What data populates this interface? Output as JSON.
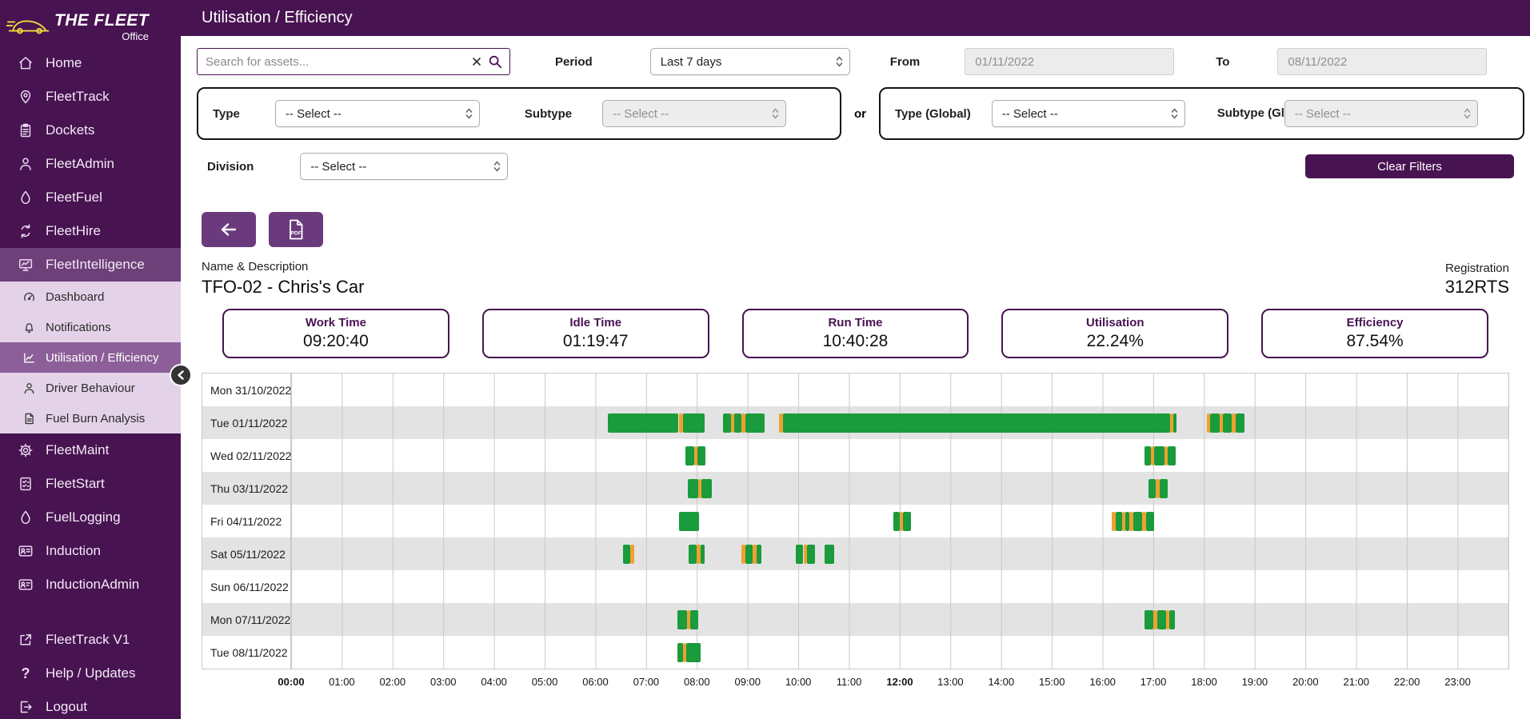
{
  "header": {
    "title": "Utilisation / Efficiency"
  },
  "sidebar": {
    "logo_title": "THE FLEET",
    "logo_subtitle": "Office",
    "items": [
      {
        "label": "Home"
      },
      {
        "label": "FleetTrack"
      },
      {
        "label": "Dockets"
      },
      {
        "label": "FleetAdmin"
      },
      {
        "label": "FleetFuel"
      },
      {
        "label": "FleetHire"
      },
      {
        "label": "FleetIntelligence"
      }
    ],
    "subitems": [
      {
        "label": "Dashboard"
      },
      {
        "label": "Notifications"
      },
      {
        "label": "Utilisation / Efficiency"
      },
      {
        "label": "Driver Behaviour"
      },
      {
        "label": "Fuel Burn Analysis"
      }
    ],
    "items2": [
      {
        "label": "FleetMaint"
      },
      {
        "label": "FleetStart"
      },
      {
        "label": "FuelLogging"
      },
      {
        "label": "Induction"
      },
      {
        "label": "InductionAdmin"
      }
    ],
    "items3": [
      {
        "label": "FleetTrack V1"
      },
      {
        "label": "Help / Updates"
      },
      {
        "label": "Logout"
      }
    ]
  },
  "filters": {
    "search_placeholder": "Search for assets...",
    "period_label": "Period",
    "period_value": "Last 7 days",
    "from_label": "From",
    "from_value": "01/11/2022",
    "to_label": "To",
    "to_value": "08/11/2022",
    "type_label": "Type",
    "type_value": "-- Select --",
    "subtype_label": "Subtype",
    "subtype_value": "-- Select --",
    "or_label": "or",
    "type_global_label": "Type (Global)",
    "type_global_value": "-- Select --",
    "subtype_global_label": "Subtype (Global)",
    "subtype_global_value": "-- Select --",
    "division_label": "Division",
    "division_value": "-- Select --",
    "clear_button": "Clear Filters"
  },
  "icons": {
    "back": "left-arrow",
    "export": "pdf-file",
    "search": "magnifier",
    "clear_search": "x-mark",
    "collapse": "chevron-left",
    "select_arrows": "chevron-up-down"
  },
  "asset": {
    "name_label": "Name & Description",
    "name": "TFO-02 - Chris's Car",
    "registration_label": "Registration",
    "registration": "312RTS"
  },
  "stats": [
    {
      "label": "Work Time",
      "value": "09:20:40"
    },
    {
      "label": "Idle Time",
      "value": "01:19:47"
    },
    {
      "label": "Run Time",
      "value": "10:40:28"
    },
    {
      "label": "Utilisation",
      "value": "22.24%"
    },
    {
      "label": "Efficiency",
      "value": "87.54%"
    }
  ],
  "colors": {
    "sidebar_bg": "#481351",
    "active_nav_bg": "#6e4079",
    "submenu_bg": "#e4d2e9",
    "submenu_active_bg": "#8d5f98",
    "accent_purple": "#6b3a7d",
    "bar_green": "#1a9b3c",
    "bar_orange": "#f0a030",
    "row_alt_gray": "#e3e3e3"
  },
  "chart_data": {
    "type": "gantt",
    "description": "Asset activity timeline per day; segments in decimal hours [start, end, color]",
    "x_axis": {
      "unit": "hour",
      "min": 0,
      "max": 24,
      "tick_labels": [
        "00:00",
        "01:00",
        "02:00",
        "03:00",
        "04:00",
        "05:00",
        "06:00",
        "07:00",
        "08:00",
        "09:00",
        "10:00",
        "11:00",
        "12:00",
        "13:00",
        "14:00",
        "15:00",
        "16:00",
        "17:00",
        "18:00",
        "19:00",
        "20:00",
        "21:00",
        "22:00",
        "23:00"
      ],
      "bold_tick_labels": [
        "00:00",
        "12:00"
      ]
    },
    "rows": [
      {
        "day": "Mon 31/10/2022",
        "segments": []
      },
      {
        "day": "Tue 01/11/2022",
        "segments": [
          [
            6.25,
            7.64,
            "green"
          ],
          [
            7.64,
            7.72,
            "orange"
          ],
          [
            7.72,
            8.15,
            "green"
          ],
          [
            8.52,
            8.67,
            "green"
          ],
          [
            8.67,
            8.74,
            "orange"
          ],
          [
            8.74,
            8.88,
            "green"
          ],
          [
            8.88,
            8.95,
            "orange"
          ],
          [
            8.95,
            9.33,
            "green"
          ],
          [
            9.62,
            9.7,
            "orange"
          ],
          [
            9.7,
            17.33,
            "green"
          ],
          [
            17.33,
            17.4,
            "orange"
          ],
          [
            17.4,
            17.46,
            "green"
          ],
          [
            18.05,
            18.12,
            "orange"
          ],
          [
            18.12,
            18.3,
            "green"
          ],
          [
            18.3,
            18.37,
            "orange"
          ],
          [
            18.37,
            18.55,
            "green"
          ],
          [
            18.55,
            18.62,
            "orange"
          ],
          [
            18.62,
            18.8,
            "green"
          ]
        ]
      },
      {
        "day": "Wed 02/11/2022",
        "segments": [
          [
            7.78,
            7.94,
            "green"
          ],
          [
            7.94,
            8.01,
            "orange"
          ],
          [
            8.01,
            8.17,
            "green"
          ],
          [
            16.82,
            16.95,
            "green"
          ],
          [
            16.95,
            17.02,
            "orange"
          ],
          [
            17.02,
            17.22,
            "green"
          ],
          [
            17.22,
            17.29,
            "orange"
          ],
          [
            17.29,
            17.44,
            "green"
          ]
        ]
      },
      {
        "day": "Thu 03/11/2022",
        "segments": [
          [
            7.82,
            8.02,
            "green"
          ],
          [
            8.02,
            8.09,
            "orange"
          ],
          [
            8.09,
            8.3,
            "green"
          ],
          [
            16.9,
            17.05,
            "green"
          ],
          [
            17.05,
            17.12,
            "orange"
          ],
          [
            17.12,
            17.28,
            "green"
          ]
        ]
      },
      {
        "day": "Fri 04/11/2022",
        "segments": [
          [
            7.65,
            8.05,
            "green"
          ],
          [
            11.88,
            12.0,
            "green"
          ],
          [
            12.0,
            12.07,
            "orange"
          ],
          [
            12.07,
            12.22,
            "green"
          ],
          [
            16.18,
            16.25,
            "orange"
          ],
          [
            16.25,
            16.38,
            "green"
          ],
          [
            16.38,
            16.45,
            "orange"
          ],
          [
            16.45,
            16.53,
            "green"
          ],
          [
            16.53,
            16.6,
            "orange"
          ],
          [
            16.6,
            16.78,
            "green"
          ],
          [
            16.78,
            16.85,
            "orange"
          ],
          [
            16.85,
            17.02,
            "green"
          ]
        ]
      },
      {
        "day": "Sat 05/11/2022",
        "segments": [
          [
            6.55,
            6.68,
            "green"
          ],
          [
            6.68,
            6.76,
            "orange"
          ],
          [
            7.84,
            8.0,
            "green"
          ],
          [
            8.0,
            8.07,
            "orange"
          ],
          [
            8.07,
            8.16,
            "green"
          ],
          [
            8.88,
            8.95,
            "orange"
          ],
          [
            8.95,
            9.1,
            "green"
          ],
          [
            9.1,
            9.17,
            "orange"
          ],
          [
            9.17,
            9.27,
            "green"
          ],
          [
            9.95,
            10.1,
            "green"
          ],
          [
            10.1,
            10.17,
            "orange"
          ],
          [
            10.17,
            10.33,
            "green"
          ],
          [
            10.52,
            10.7,
            "green"
          ]
        ]
      },
      {
        "day": "Sun 06/11/2022",
        "segments": []
      },
      {
        "day": "Mon 07/11/2022",
        "segments": [
          [
            7.62,
            7.8,
            "green"
          ],
          [
            7.8,
            7.87,
            "orange"
          ],
          [
            7.87,
            8.03,
            "green"
          ],
          [
            16.82,
            17.0,
            "green"
          ],
          [
            17.0,
            17.07,
            "orange"
          ],
          [
            17.07,
            17.25,
            "green"
          ],
          [
            17.25,
            17.31,
            "orange"
          ],
          [
            17.31,
            17.42,
            "green"
          ]
        ]
      },
      {
        "day": "Tue 08/11/2022",
        "segments": [
          [
            7.62,
            7.72,
            "green"
          ],
          [
            7.72,
            7.79,
            "orange"
          ],
          [
            7.79,
            8.08,
            "green"
          ]
        ]
      }
    ]
  }
}
